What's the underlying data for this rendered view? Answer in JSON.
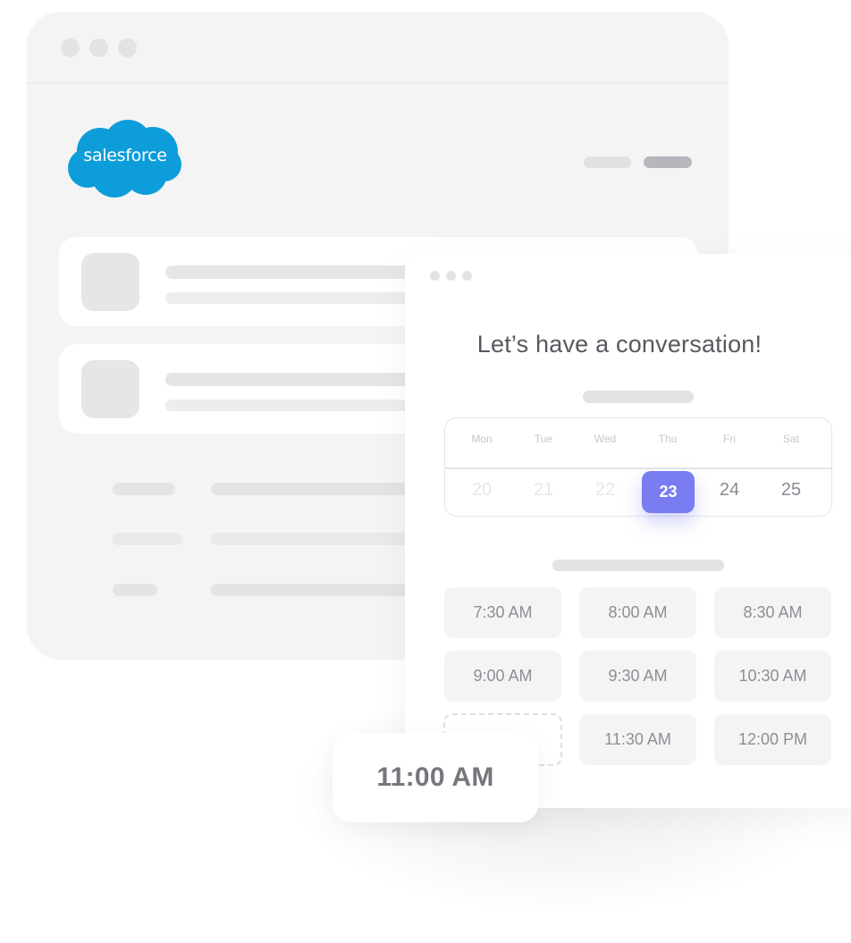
{
  "brand": {
    "logo_text": "salesforce",
    "logo_color": "#0d9dda"
  },
  "booking": {
    "heading": "Let’s have a conversation!",
    "accent_color": "#7a7cf2",
    "calendar": {
      "days": [
        {
          "day": "Mon",
          "date": "20",
          "state": "disabled"
        },
        {
          "day": "Tue",
          "date": "21",
          "state": "disabled"
        },
        {
          "day": "Wed",
          "date": "22",
          "state": "disabled"
        },
        {
          "day": "Thu",
          "date": "23",
          "state": "selected"
        },
        {
          "day": "Fri",
          "date": "24",
          "state": "available"
        },
        {
          "day": "Sat",
          "date": "25",
          "state": "available"
        }
      ]
    },
    "time_slots": [
      {
        "label": "7:30 AM"
      },
      {
        "label": "8:00 AM"
      },
      {
        "label": "8:30 AM"
      },
      {
        "label": "9:00 AM"
      },
      {
        "label": "9:30 AM"
      },
      {
        "label": "10:30 AM"
      },
      {
        "label": ""
      },
      {
        "label": "11:30 AM"
      },
      {
        "label": "12:00 PM"
      }
    ],
    "dragged_slot": "11:00 AM"
  }
}
